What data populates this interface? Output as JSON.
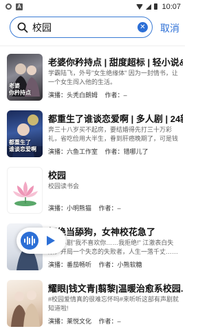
{
  "status_bar": {
    "time": "10:07"
  },
  "search": {
    "query": "校园",
    "cancel_label": "取消"
  },
  "labels": {
    "narrator": "演播：",
    "author": "作者："
  },
  "results": [
    {
      "title": "老婆你矜持点 | 甜度超标 | 轻小说&...",
      "desc": "学霸陆飞，外号\"女生绝缘体\" 因为一封情书，让一个女生闯入他的生活。",
      "narrator": "头秃白朗姆",
      "author": "–",
      "cover_caption": "老婆\n你矜持点"
    },
    {
      "title": "都重生了谁谈恋爱啊 | 多人剧 | 24新...",
      "desc": "奔三十八岁买不起房，要结婚得先打三十万彩礼，省吃俭用大半生，眷到肝癌晚期了，可是钱呢?钱呢",
      "narrator": "六鱼工作室",
      "author": "错哪儿了",
      "cover_caption": "都重生了\n谁谈恋爱啊"
    },
    {
      "title": "校园",
      "desc": "校园读书会",
      "narrator": "小明熊猫",
      "author": "–",
      "cover_caption": ""
    },
    {
      "title": "拒绝当舔狗，女神校花急了",
      "desc": "我有声剧\"我不喜欢你……我拒绝!\" 江澈表白失败，开局一个失恋的失败者，人生一落千丈……一场意外，让他……",
      "narrator": "番茄畅听",
      "author": "小熊软糖",
      "cover_caption": ""
    },
    {
      "title": "耀眼|钱文青|翦黎|温暖治愈系校园...",
      "desc": "#校园爱情真的很难忘怀吗#来听听这部有声剧就知道啦!",
      "narrator": "莱悦文化",
      "author": "–",
      "cover_caption": ""
    }
  ]
}
